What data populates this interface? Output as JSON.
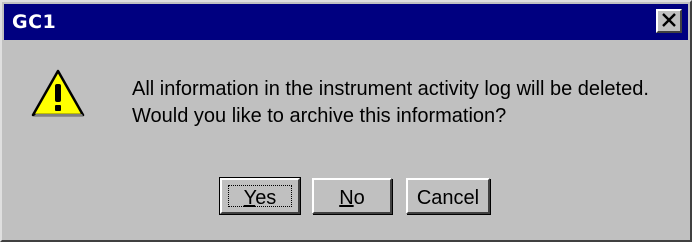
{
  "window": {
    "title": "GC1",
    "close_icon": "close-icon"
  },
  "message": {
    "icon": "warning-icon",
    "line1": "All information in the instrument activity log will be deleted.",
    "line2": "Would you like to archive this information?"
  },
  "buttons": {
    "yes": {
      "mnemonic": "Y",
      "rest": "es"
    },
    "no": {
      "mnemonic": "N",
      "rest": "o"
    },
    "cancel": {
      "label": "Cancel"
    }
  },
  "colors": {
    "titlebar": "#000080",
    "face": "#c0c0c0",
    "warning_fill": "#ffff00"
  }
}
